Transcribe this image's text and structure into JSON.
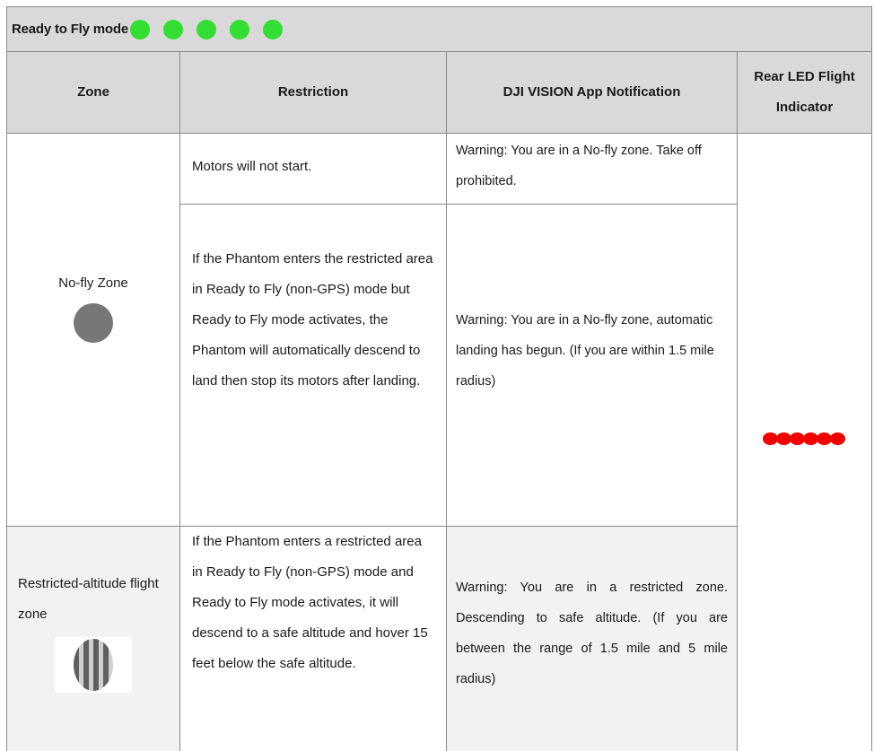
{
  "banner": {
    "title": "Ready to Fly mode",
    "dot_count": 5,
    "dot_color": "#33dd33"
  },
  "headers": {
    "zone": "Zone",
    "restriction": "Restriction",
    "notification": "DJI VISION App Notification",
    "led": "Rear LED Flight Indicator"
  },
  "rows": {
    "no_fly": {
      "zone_label": "No-fly Zone",
      "zone_icon": "gray-circle-icon",
      "restriction_1": "Motors will not start.",
      "notification_1": "Warning: You are in a No-fly zone. Take off prohibited.",
      "restriction_2": "If the Phantom enters the restricted area in Ready to Fly (non-GPS) mode but Ready to Fly mode activates, the Phantom will automatically descend to land then stop its motors after landing.",
      "notification_2": "Warning: You are in a No-fly zone, automatic landing has begun. (If you are within 1.5 mile radius)"
    },
    "restricted_altitude": {
      "zone_label": "Restricted-altitude flight zone",
      "zone_icon": "striped-circle-icon",
      "restriction": "If the Phantom enters a restricted area in Ready to Fly (non-GPS) mode and Ready to Fly mode activates, it will descend to a safe altitude and hover 15 feet below the safe altitude.",
      "notification": "Warning: You are in a restricted zone. Descending to safe altitude. (If you are between the range of 1.5 mile and 5 mile radius)"
    }
  },
  "led_indicator": {
    "icon": "red-led-dots-icon",
    "dot_count": 6,
    "color": "#f20000"
  }
}
